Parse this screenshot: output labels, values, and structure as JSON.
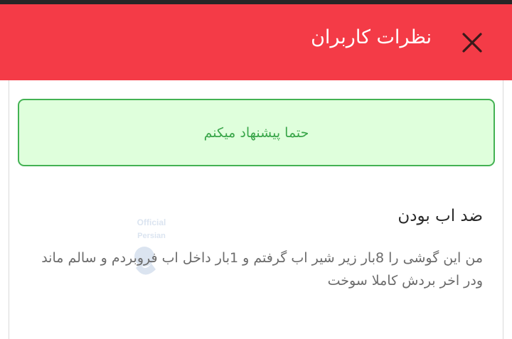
{
  "header": {
    "title": "نظرات کاربران",
    "background_color": "#f43b47",
    "close_icon": "close-icon"
  },
  "recommendation": {
    "text": "حتما پیشنهاد میکنم",
    "background_color": "#dfffdc",
    "border_color": "#43b253",
    "text_color": "#3aa64a"
  },
  "review": {
    "title": "ضد اب بودن",
    "body": "من این گوشی را 8بار زیر شیر اب گرفتم و 1بار داخل اب فروبردم و سالم ماند ودر اخر بردش کاملا سوخت"
  },
  "watermark": {
    "line1": "Official",
    "line2": "Persian"
  }
}
